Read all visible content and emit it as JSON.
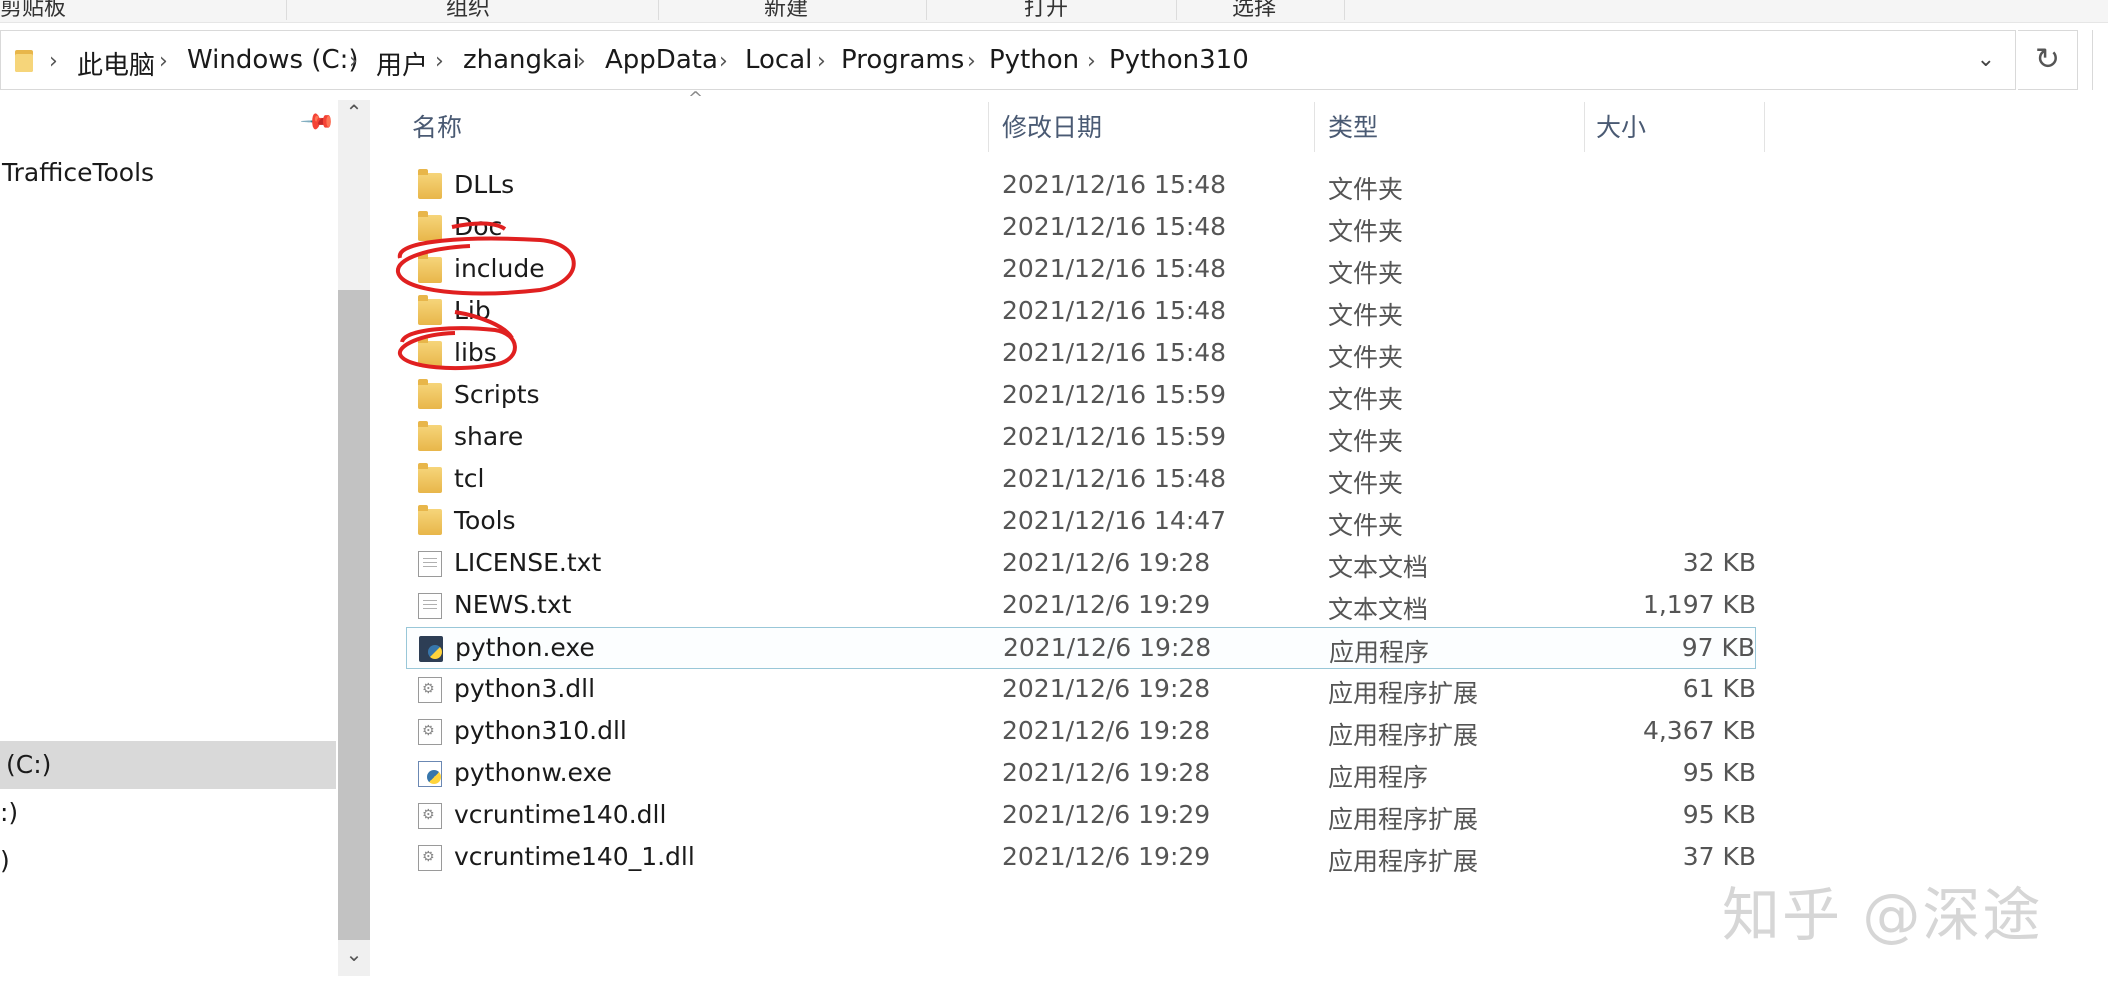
{
  "ribbon": {
    "groups": [
      "剪贴板",
      "组织",
      "新建",
      "打开",
      "选择"
    ]
  },
  "address": {
    "crumbs": [
      "此电脑",
      "Windows (C:)",
      "用户",
      "zhangkai",
      "AppData",
      "Local",
      "Programs",
      "Python",
      "Python310"
    ],
    "folder_icon": "folder-icon",
    "dropdown_icon": "chevron-down-icon",
    "refresh_icon": "refresh-icon",
    "chevron_glyph": "›"
  },
  "nav": {
    "items": [
      "TrafficeTools",
      "(C:)",
      ":)",
      ")"
    ],
    "pin_icon": "pin-icon"
  },
  "columns": {
    "name": "名称",
    "date": "修改日期",
    "type": "类型",
    "size": "大小"
  },
  "files": [
    {
      "name": "DLLs",
      "date": "2021/12/16 15:48",
      "type": "文件夹",
      "size": "",
      "icon": "folder"
    },
    {
      "name": "Doc",
      "date": "2021/12/16 15:48",
      "type": "文件夹",
      "size": "",
      "icon": "folder"
    },
    {
      "name": "include",
      "date": "2021/12/16 15:48",
      "type": "文件夹",
      "size": "",
      "icon": "folder"
    },
    {
      "name": "Lib",
      "date": "2021/12/16 15:48",
      "type": "文件夹",
      "size": "",
      "icon": "folder"
    },
    {
      "name": "libs",
      "date": "2021/12/16 15:48",
      "type": "文件夹",
      "size": "",
      "icon": "folder"
    },
    {
      "name": "Scripts",
      "date": "2021/12/16 15:59",
      "type": "文件夹",
      "size": "",
      "icon": "folder"
    },
    {
      "name": "share",
      "date": "2021/12/16 15:59",
      "type": "文件夹",
      "size": "",
      "icon": "folder"
    },
    {
      "name": "tcl",
      "date": "2021/12/16 15:48",
      "type": "文件夹",
      "size": "",
      "icon": "folder"
    },
    {
      "name": "Tools",
      "date": "2021/12/16 14:47",
      "type": "文件夹",
      "size": "",
      "icon": "folder"
    },
    {
      "name": "LICENSE.txt",
      "date": "2021/12/6 19:28",
      "type": "文本文档",
      "size": "32 KB",
      "icon": "txt"
    },
    {
      "name": "NEWS.txt",
      "date": "2021/12/6 19:29",
      "type": "文本文档",
      "size": "1,197 KB",
      "icon": "txt"
    },
    {
      "name": "python.exe",
      "date": "2021/12/6 19:28",
      "type": "应用程序",
      "size": "97 KB",
      "icon": "exe"
    },
    {
      "name": "python3.dll",
      "date": "2021/12/6 19:28",
      "type": "应用程序扩展",
      "size": "61 KB",
      "icon": "dll"
    },
    {
      "name": "python310.dll",
      "date": "2021/12/6 19:28",
      "type": "应用程序扩展",
      "size": "4,367 KB",
      "icon": "dll"
    },
    {
      "name": "pythonw.exe",
      "date": "2021/12/6 19:28",
      "type": "应用程序",
      "size": "95 KB",
      "icon": "exew"
    },
    {
      "name": "vcruntime140.dll",
      "date": "2021/12/6 19:29",
      "type": "应用程序扩展",
      "size": "95 KB",
      "icon": "dll"
    },
    {
      "name": "vcruntime140_1.dll",
      "date": "2021/12/6 19:29",
      "type": "应用程序扩展",
      "size": "37 KB",
      "icon": "dll"
    }
  ],
  "selected_file": "python.exe",
  "annotation_color": "#e02020",
  "watermark": "知乎 @深途"
}
